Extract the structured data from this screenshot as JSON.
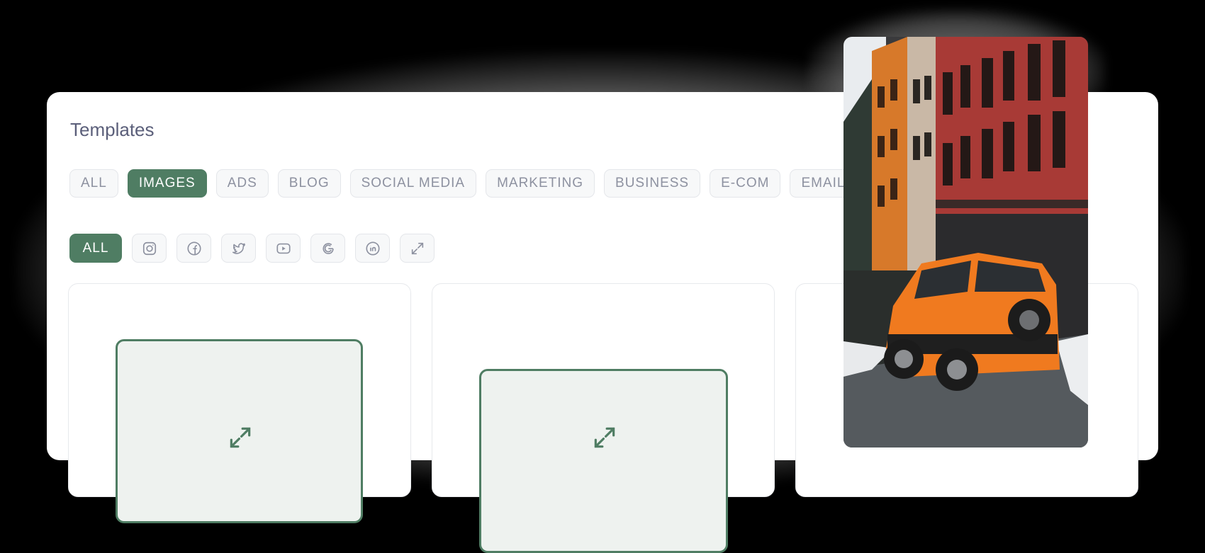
{
  "panel": {
    "title": "Templates"
  },
  "categories": [
    {
      "label": "ALL",
      "active": false
    },
    {
      "label": "IMAGES",
      "active": true
    },
    {
      "label": "ADS",
      "active": false
    },
    {
      "label": "BLOG",
      "active": false
    },
    {
      "label": "SOCIAL MEDIA",
      "active": false
    },
    {
      "label": "MARKETING",
      "active": false
    },
    {
      "label": "BUSINESS",
      "active": false
    },
    {
      "label": "E-COM",
      "active": false
    },
    {
      "label": "EMAIL",
      "active": false
    }
  ],
  "platforms": {
    "all_label": "ALL",
    "icons": [
      "instagram-icon",
      "facebook-icon",
      "twitter-icon",
      "youtube-icon",
      "google-icon",
      "linkedin-icon",
      "expand-icon"
    ]
  },
  "colors": {
    "accent": "#4f7d63",
    "chip_text": "#8d91a0",
    "title_text": "#5b5f7a"
  }
}
